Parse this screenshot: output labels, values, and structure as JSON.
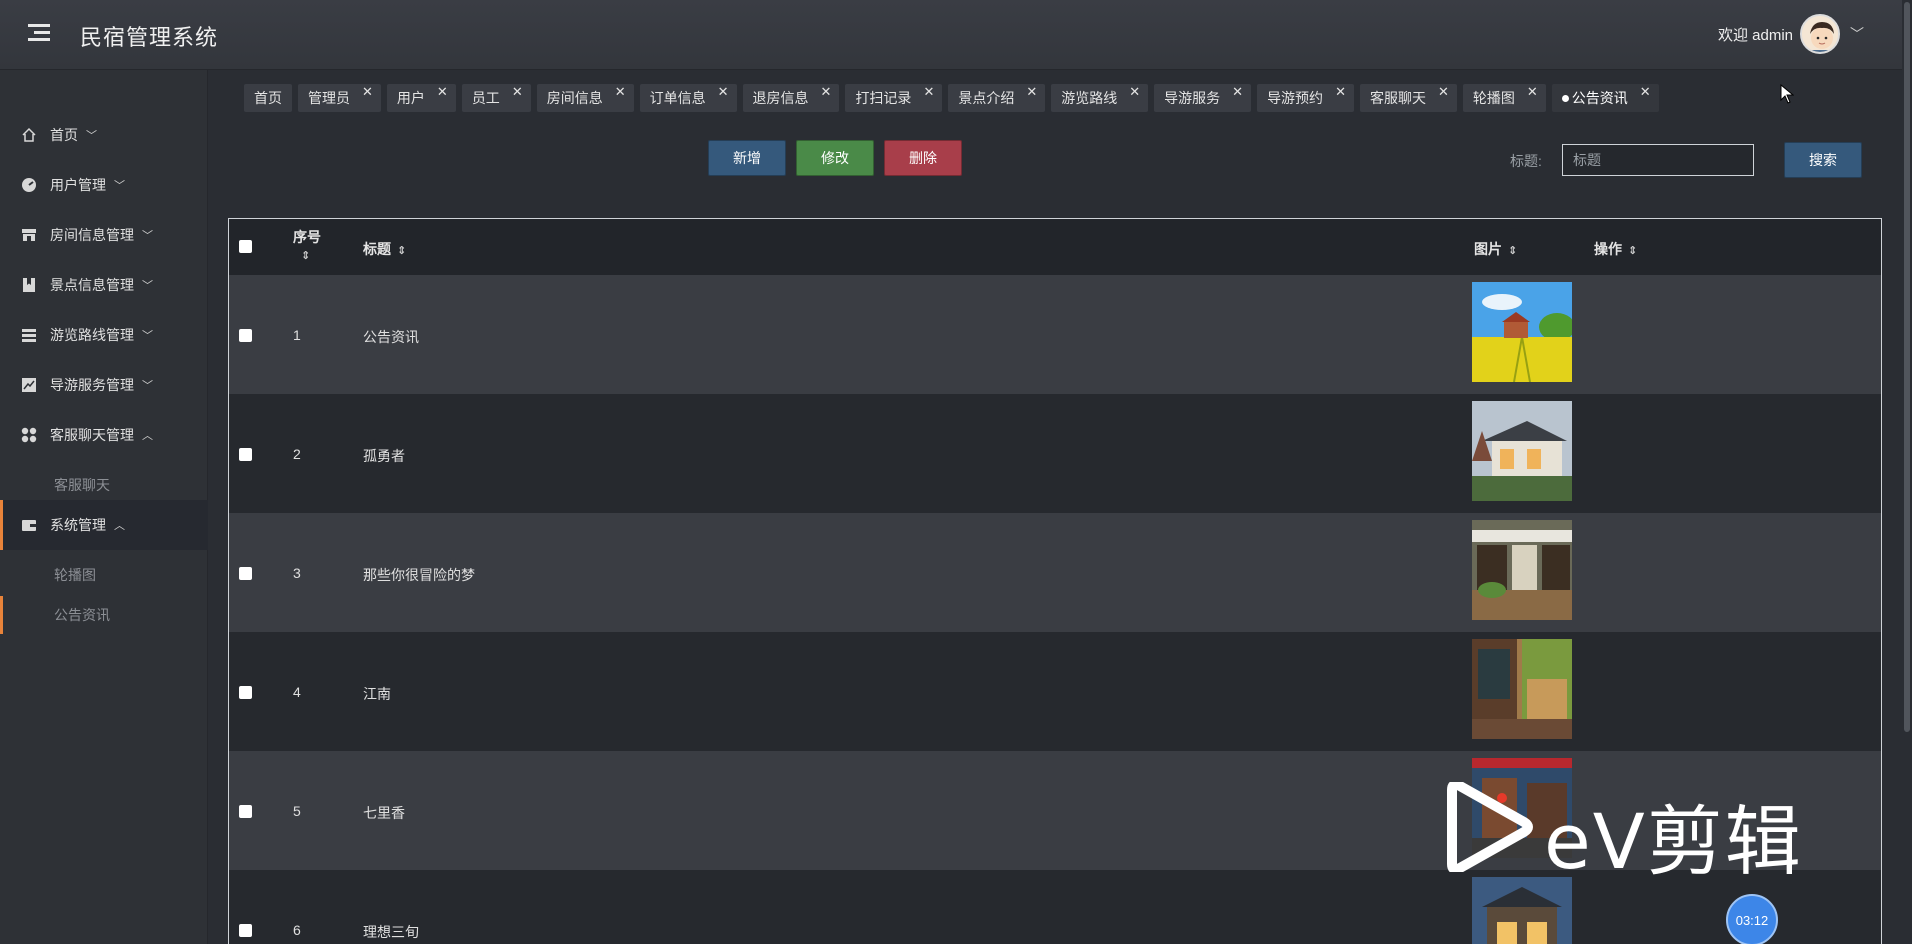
{
  "header": {
    "title": "民宿管理系统",
    "welcome": "欢迎 admin"
  },
  "sidebar": {
    "items": [
      {
        "label": "首页",
        "icon": "home-icon"
      },
      {
        "label": "用户管理",
        "icon": "dashboard-icon"
      },
      {
        "label": "房间信息管理",
        "icon": "store-icon"
      },
      {
        "label": "景点信息管理",
        "icon": "bookmark-icon"
      },
      {
        "label": "游览路线管理",
        "icon": "list-icon"
      },
      {
        "label": "导游服务管理",
        "icon": "chart-icon"
      },
      {
        "label": "客服聊天管理",
        "icon": "grid-icon"
      },
      {
        "label": "系统管理",
        "icon": "wallet-icon"
      }
    ],
    "chat_sub": "客服聊天",
    "system_sub": [
      "轮播图",
      "公告资讯"
    ]
  },
  "tabs": [
    "首页",
    "管理员",
    "用户",
    "员工",
    "房间信息",
    "订单信息",
    "退房信息",
    "打扫记录",
    "景点介绍",
    "游览路线",
    "导游服务",
    "导游预约",
    "客服聊天",
    "轮播图",
    "公告资讯"
  ],
  "toolbar": {
    "add": "新增",
    "edit": "修改",
    "delete": "删除",
    "search_label": "标题:",
    "search_placeholder": "标题",
    "search": "搜索"
  },
  "table": {
    "headers": {
      "index": "序号",
      "title": "标题",
      "image": "图片",
      "action": "操作"
    },
    "rows": [
      {
        "index": "1",
        "title": "公告资讯"
      },
      {
        "index": "2",
        "title": "孤勇者"
      },
      {
        "index": "3",
        "title": "那些你很冒险的梦"
      },
      {
        "index": "4",
        "title": "江南"
      },
      {
        "index": "5",
        "title": "七里香"
      },
      {
        "index": "6",
        "title": "理想三旬"
      }
    ]
  },
  "overlay": {
    "watermark": "eV剪辑",
    "timer": "03:12"
  },
  "colors": {
    "accent": "#e8833a",
    "primary_button": "#35597c",
    "edit_button": "#4a8a48",
    "delete_button": "#a83e4a"
  }
}
